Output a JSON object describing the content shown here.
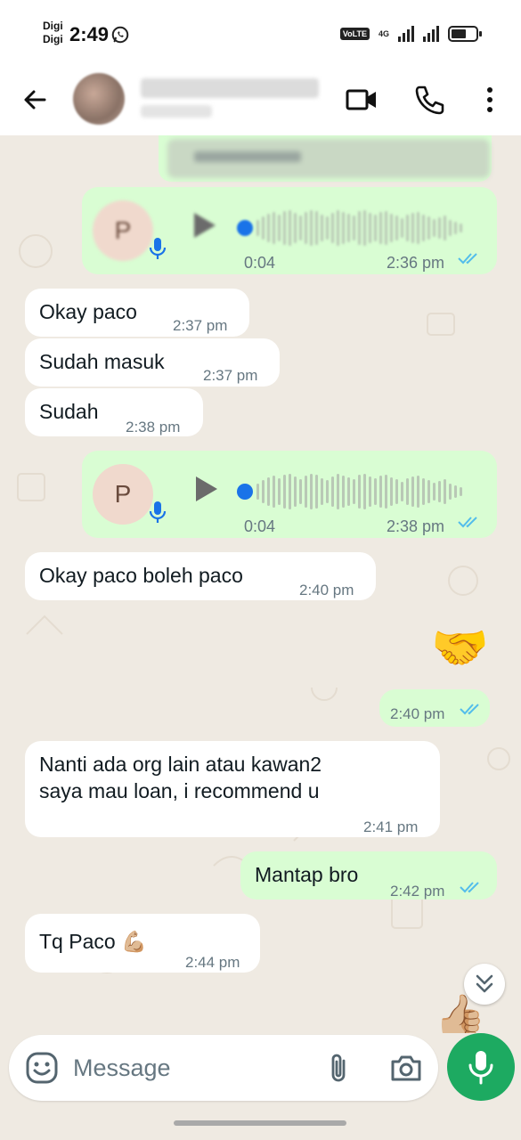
{
  "status_bar": {
    "carrier_1": "Digi",
    "carrier_2": "Digi",
    "time": "2:49",
    "volte": "VoLTE",
    "network": "4G"
  },
  "header": {
    "contact_name": "▇▇▇▇▇▇▇▇▇▇▇▇",
    "contact_status": "▇▇▇▇▇▇"
  },
  "messages": [
    {
      "id": "quoted-blurred",
      "type": "quote"
    },
    {
      "id": "voice-1",
      "direction": "out",
      "type": "voice",
      "avatar_letter": "P",
      "duration": "0:04",
      "time": "2:36 pm",
      "status": "read"
    },
    {
      "id": "m1",
      "direction": "in",
      "text": "Okay paco",
      "time": "2:37 pm"
    },
    {
      "id": "m2",
      "direction": "in",
      "text": "Sudah masuk",
      "time": "2:37 pm"
    },
    {
      "id": "m3",
      "direction": "in",
      "text": "Sudah",
      "time": "2:38 pm"
    },
    {
      "id": "voice-2",
      "direction": "out",
      "type": "voice",
      "avatar_letter": "P",
      "duration": "0:04",
      "time": "2:38 pm",
      "status": "read"
    },
    {
      "id": "m4",
      "direction": "in",
      "text": "Okay paco boleh paco",
      "time": "2:40 pm"
    },
    {
      "id": "m5",
      "direction": "out",
      "type": "emoji",
      "emoji": "🤝",
      "time": "2:40 pm",
      "status": "read"
    },
    {
      "id": "m6",
      "direction": "in",
      "lines": [
        "Nanti ada org lain atau kawan2",
        "saya mau loan, i recommend u"
      ],
      "time": "2:41 pm"
    },
    {
      "id": "m7",
      "direction": "out",
      "text": "Mantap bro",
      "time": "2:42 pm",
      "status": "read"
    },
    {
      "id": "m8",
      "direction": "in",
      "text": "Tq Paco 💪🏼",
      "time": "2:44 pm"
    },
    {
      "id": "m9",
      "direction": "out",
      "type": "emoji",
      "emoji": "👍🏼",
      "partial": true
    }
  ],
  "composer": {
    "placeholder": "Message"
  },
  "colors": {
    "incoming": "#ffffff",
    "outgoing": "#d9fdd3",
    "chat_bg": "#efeae2",
    "accent_green": "#1daa61",
    "read_ticks": "#53bdeb",
    "timestamp": "#667781"
  },
  "icons": {
    "back": "arrow-left-icon",
    "video": "video-camera-icon",
    "call": "phone-icon",
    "more": "more-vertical-icon",
    "emoji": "emoji-icon",
    "attach": "paperclip-icon",
    "camera": "camera-icon",
    "mic": "microphone-icon",
    "scroll_down": "chevron-double-down-icon"
  }
}
